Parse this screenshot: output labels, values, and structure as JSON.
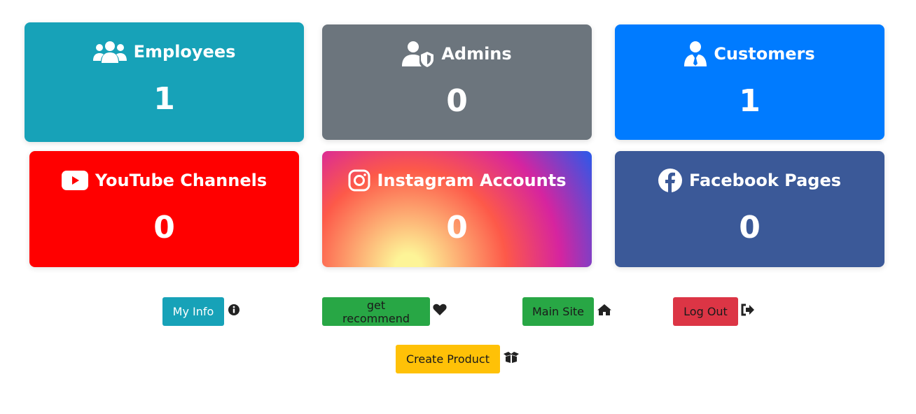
{
  "cards": {
    "employees": {
      "title": "Employees",
      "count": "1",
      "icon": "users-icon",
      "color": "#17a2b8"
    },
    "admins": {
      "title": "Admins",
      "count": "0",
      "icon": "user-shield-icon",
      "color": "#6c757d"
    },
    "customers": {
      "title": "Customers",
      "count": "1",
      "icon": "user-tie-icon",
      "color": "#007bff"
    },
    "youtube": {
      "title": "YouTube Channels",
      "count": "0",
      "icon": "youtube-icon",
      "color": "#ff0000"
    },
    "instagram": {
      "title": "Instagram Accounts",
      "count": "0",
      "icon": "instagram-icon",
      "color": "gradient"
    },
    "facebook": {
      "title": "Facebook Pages",
      "count": "0",
      "icon": "facebook-icon",
      "color": "#3b5998"
    }
  },
  "buttons": {
    "my_info": {
      "label": "My Info",
      "icon": "info-circle-icon",
      "color": "#17a2b8"
    },
    "get_recommend": {
      "label": "get recommend",
      "icon": "heart-icon",
      "color": "#28a745"
    },
    "main_site": {
      "label": "Main Site",
      "icon": "home-icon",
      "color": "#28a745"
    },
    "log_out": {
      "label": "Log Out",
      "icon": "sign-out-icon",
      "color": "#dc3545"
    },
    "create_product": {
      "label": "Create Product",
      "icon": "box-open-icon",
      "color": "#ffc107"
    }
  }
}
